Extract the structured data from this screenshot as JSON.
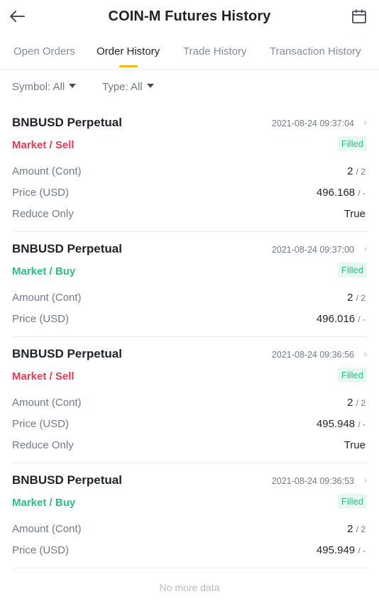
{
  "header": {
    "title": "COIN-M Futures History",
    "back_icon": "arrow-left-icon",
    "calendar_icon": "calendar-icon"
  },
  "tabs": [
    {
      "label": "Open Orders",
      "active": false
    },
    {
      "label": "Order History",
      "active": true
    },
    {
      "label": "Trade History",
      "active": false
    },
    {
      "label": "Transaction History",
      "active": false
    }
  ],
  "filters": {
    "symbol_label": "Symbol: All",
    "type_label": "Type: All"
  },
  "labels": {
    "amount": "Amount (Cont)",
    "price": "Price (USD)",
    "reduce_only": "Reduce Only"
  },
  "orders": [
    {
      "symbol": "BNBUSD Perpetual",
      "time": "2021-08-24 09:37:04",
      "side": "Market / Sell",
      "status": "Filled",
      "amount": "2",
      "amount_sub": "/ 2",
      "price": "496.168",
      "price_sub": "/ -",
      "reduce_only": "True"
    },
    {
      "symbol": "BNBUSD Perpetual",
      "time": "2021-08-24 09:37:00",
      "side": "Market / Buy",
      "status": "Filled",
      "amount": "2",
      "amount_sub": "/ 2",
      "price": "496.016",
      "price_sub": "/ -"
    },
    {
      "symbol": "BNBUSD Perpetual",
      "time": "2021-08-24 09:36:56",
      "side": "Market / Sell",
      "status": "Filled",
      "amount": "2",
      "amount_sub": "/ 2",
      "price": "495.948",
      "price_sub": "/ -",
      "reduce_only": "True"
    },
    {
      "symbol": "BNBUSD Perpetual",
      "time": "2021-08-24 09:36:53",
      "side": "Market / Buy",
      "status": "Filled",
      "amount": "2",
      "amount_sub": "/ 2",
      "price": "495.949",
      "price_sub": "/ -"
    }
  ],
  "footer": {
    "no_more": "No more data"
  },
  "colors": {
    "accent": "#f0b90b",
    "sell": "#e03e54",
    "buy": "#2ebd85"
  }
}
